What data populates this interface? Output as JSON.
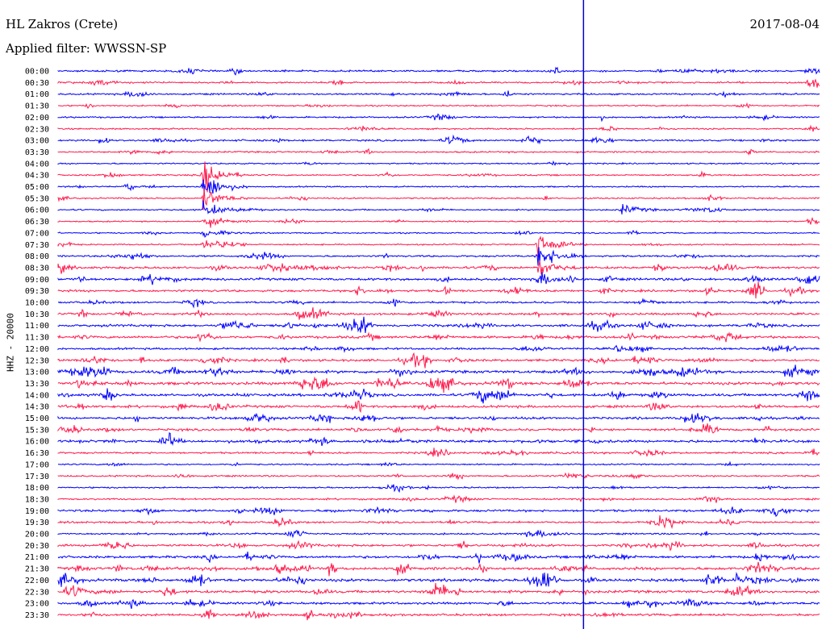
{
  "header": {
    "station": "HL Zakros (Crete)",
    "filter": "Applied filter: WWSSN-SP",
    "date": "2017-08-04"
  },
  "axis": {
    "ylabel": "HHZ - 20000"
  },
  "chart_data": {
    "type": "line",
    "title": "HL Zakros (Crete)",
    "subtitle": "Applied filter: WWSSN-SP",
    "date": "2017-08-04",
    "ylabel": "HHZ - 20000",
    "row_labels": [
      "00:00",
      "00:30",
      "01:00",
      "01:30",
      "02:00",
      "02:30",
      "03:00",
      "03:30",
      "04:00",
      "04:30",
      "05:00",
      "05:30",
      "06:00",
      "06:30",
      "07:00",
      "07:30",
      "08:00",
      "08:30",
      "09:00",
      "09:30",
      "10:00",
      "10:30",
      "11:00",
      "11:30",
      "12:00",
      "12:30",
      "13:00",
      "13:30",
      "14:00",
      "14:30",
      "15:00",
      "15:30",
      "16:00",
      "16:30",
      "17:00",
      "17:30",
      "18:00",
      "18:30",
      "19:00",
      "19:30",
      "20:00",
      "20:30",
      "21:00",
      "21:30",
      "22:00",
      "22:30",
      "23:00",
      "23:30"
    ],
    "row_colors": [
      "#0000ff",
      "#ff1a4d"
    ],
    "row_noise_level": [
      0.5,
      0.45,
      0.45,
      0.3,
      0.4,
      0.35,
      0.55,
      0.4,
      0.3,
      0.35,
      0.3,
      0.35,
      0.35,
      0.3,
      0.25,
      0.3,
      0.5,
      0.75,
      0.8,
      0.7,
      0.55,
      0.65,
      0.8,
      0.85,
      0.6,
      0.75,
      1.0,
      1.0,
      0.9,
      0.8,
      0.75,
      0.75,
      0.9,
      0.5,
      0.35,
      0.4,
      0.35,
      0.45,
      0.7,
      0.55,
      0.45,
      0.75,
      0.8,
      1.0,
      1.0,
      0.9,
      0.75,
      0.7
    ],
    "events": [
      {
        "row": 9,
        "x_fraction": 0.19,
        "amplitude": 1.0,
        "duration_rows": 7
      },
      {
        "row": 15,
        "x_fraction": 0.63,
        "amplitude": 0.8,
        "duration_rows": 4
      },
      {
        "row": 1,
        "x_fraction": 0.985,
        "amplitude": 0.5,
        "duration_rows": 1
      },
      {
        "row": 12,
        "x_fraction": 0.74,
        "amplitude": 0.3,
        "duration_rows": 1
      }
    ],
    "time_marker_fraction": 0.69,
    "marker_color": "#0000cc",
    "grid": false
  }
}
